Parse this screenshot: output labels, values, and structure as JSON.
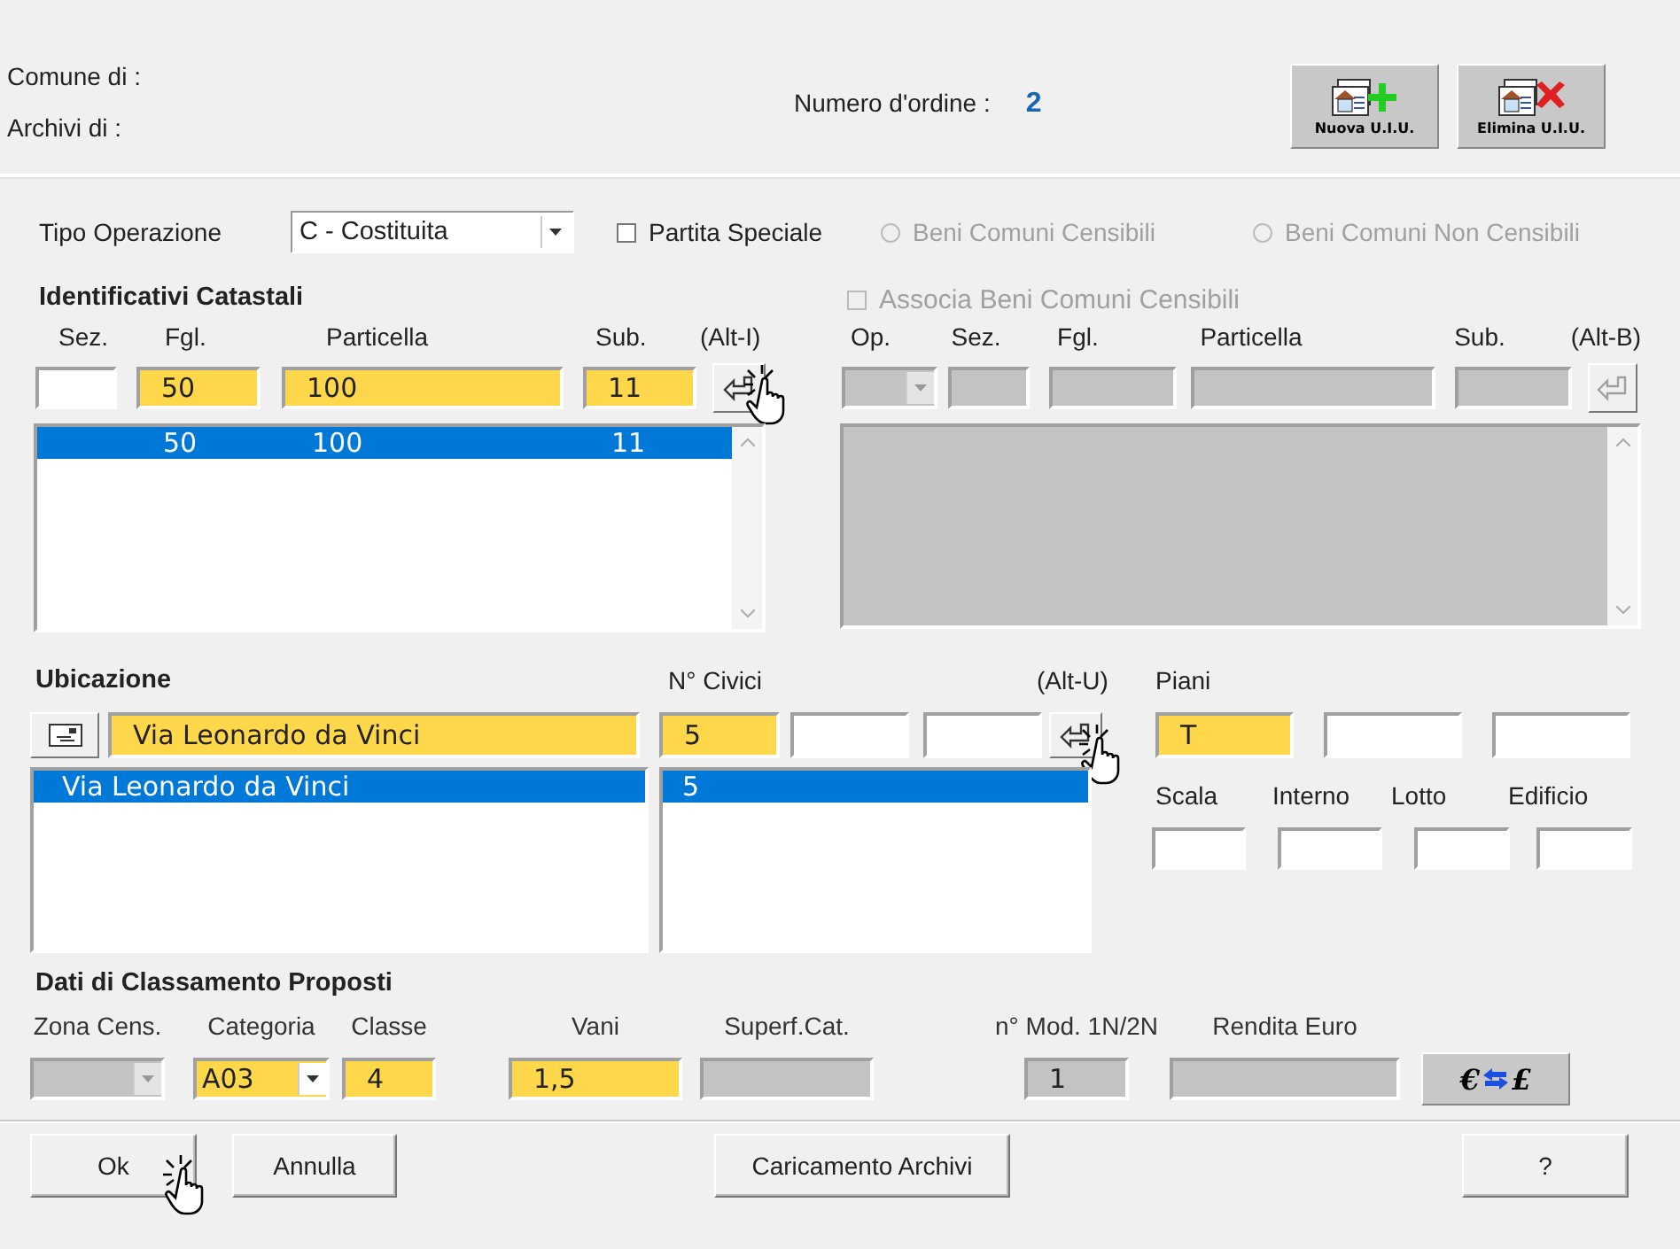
{
  "header": {
    "comune_label": "Comune di  :",
    "archivi_label": "Archivi di    :",
    "order_label": "Numero d'ordine :",
    "order_number": "2",
    "tools": [
      {
        "kind": "add",
        "label": "Nuova U.I.U."
      },
      {
        "kind": "delete",
        "label": "Elimina U.I.U."
      }
    ]
  },
  "operation": {
    "label": "Tipo Operazione",
    "value": "C - Costituita",
    "special": {
      "label": "Partita Speciale",
      "checked": false
    },
    "options": [
      {
        "label": "Beni Comuni Censibili",
        "selected": false,
        "disabled": true
      },
      {
        "label": "Beni Comuni Non Censibili",
        "selected": false,
        "disabled": true
      }
    ]
  },
  "identificativi": {
    "title": "Identificativi Catastali",
    "shortcut": "(Alt-I)",
    "labels": [
      "Sez.",
      "Fgl.",
      "Particella",
      "Sub."
    ],
    "fields": [
      {
        "kind": "plain"
      },
      {
        "value": "50",
        "kind": "required"
      },
      {
        "value": "100",
        "kind": "required"
      },
      {
        "value": "11",
        "kind": "required"
      }
    ],
    "entries": [
      {
        "values": [
          "50",
          "100",
          "11"
        ],
        "selected": true
      }
    ]
  },
  "associa": {
    "label": "Associa Beni Comuni Censibili",
    "checked": false,
    "disabled": true,
    "shortcut": "(Alt-B)",
    "labels": [
      "Op.",
      "Sez.",
      "Fgl.",
      "Particella",
      "Sub."
    ]
  },
  "ubicazione": {
    "title": "Ubicazione",
    "address": {
      "value": "Via Leonardo da Vinci",
      "kind": "required"
    },
    "civici_label": "N° Civici",
    "civici": [
      {
        "value": "5",
        "kind": "required"
      },
      {
        "kind": "plain"
      },
      {
        "kind": "plain"
      }
    ],
    "shortcut": "(Alt-U)",
    "piani_label": "Piani",
    "piani": [
      {
        "value": "T",
        "kind": "required"
      },
      {
        "kind": "plain"
      },
      {
        "kind": "plain"
      }
    ],
    "addresses": [
      {
        "text": "Via Leonardo da Vinci",
        "selected": true
      }
    ],
    "numbers": [
      {
        "text": "5",
        "selected": true
      }
    ],
    "extra": [
      {
        "label": "Scala"
      },
      {
        "label": "Interno"
      },
      {
        "label": "Lotto"
      },
      {
        "label": "Edificio"
      }
    ]
  },
  "classamento": {
    "title": "Dati di Classamento Proposti",
    "fields": [
      {
        "label": "Zona Cens.",
        "kind": "disabled-combo"
      },
      {
        "label": "Categoria",
        "value": "A03",
        "kind": "required-combo"
      },
      {
        "label": "Classe",
        "value": "4",
        "kind": "required"
      },
      {
        "label": "Vani",
        "value": "1,5",
        "kind": "required"
      },
      {
        "label": "Superf.Cat.",
        "kind": "disabled"
      },
      {
        "label": "n° Mod. 1N/2N",
        "value": "1",
        "kind": "disabled"
      },
      {
        "label": "Rendita  Euro",
        "kind": "disabled"
      }
    ],
    "currency": {
      "from": "€",
      "to": "£"
    }
  },
  "buttons": [
    "Ok",
    "Annulla",
    "Caricamento Archivi",
    "?"
  ]
}
